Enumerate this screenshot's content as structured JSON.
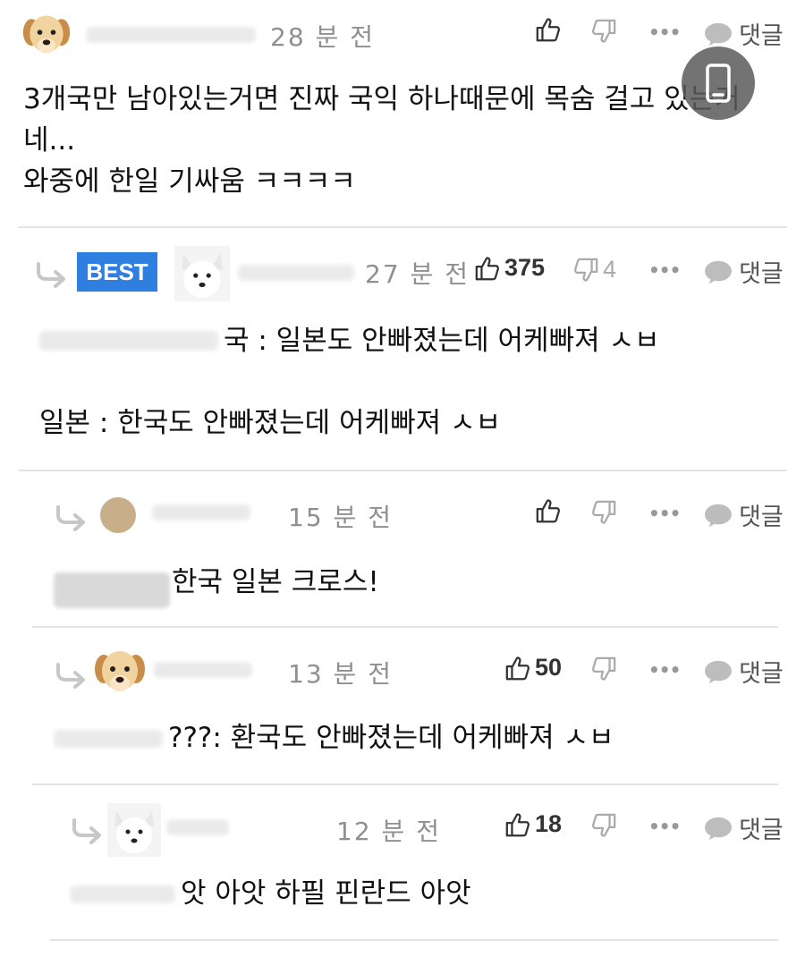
{
  "comments": [
    {
      "time": "28 분 전",
      "reply_label": "댓글",
      "text_lines": [
        "3개국만 남아있는거면 진짜 국익 하나때문에 목숨 걸고 있는거",
        "네...",
        "와중에 한일 기싸움 ㅋㅋㅋㅋ"
      ]
    },
    {
      "badge": "BEST",
      "time": "27 분 전",
      "likes": "375",
      "dislikes": "4",
      "reply_label": "댓글",
      "text_lines": [
        "국 : 일본도 안빠졌는데 어케빠져 ㅅㅂ",
        "일본 : 한국도 안빠졌는데 어케빠져 ㅅㅂ"
      ]
    },
    {
      "time": "15 분 전",
      "reply_label": "댓글",
      "text_lines": [
        "한국 일본 크로스!"
      ]
    },
    {
      "time": "13 분 전",
      "likes": "50",
      "reply_label": "댓글",
      "text_lines": [
        "???: 환국도 안빠졌는데 어케빠져 ㅅㅂ"
      ]
    },
    {
      "time": "12 분 전",
      "likes": "18",
      "reply_label": "댓글",
      "text_lines": [
        "앗 아앗 하필 핀란드 아앗"
      ]
    }
  ],
  "icons": {
    "like": "thumbs-up-icon",
    "dislike": "thumbs-down-icon",
    "more": "more-icon",
    "reply": "speech-bubble-icon",
    "reply_arrow": "reply-arrow-icon",
    "floating": "phone-icon"
  },
  "colors": {
    "best_badge": "#2f7fe0",
    "muted": "#8f8f8f",
    "divider": "#e4e4e4"
  }
}
